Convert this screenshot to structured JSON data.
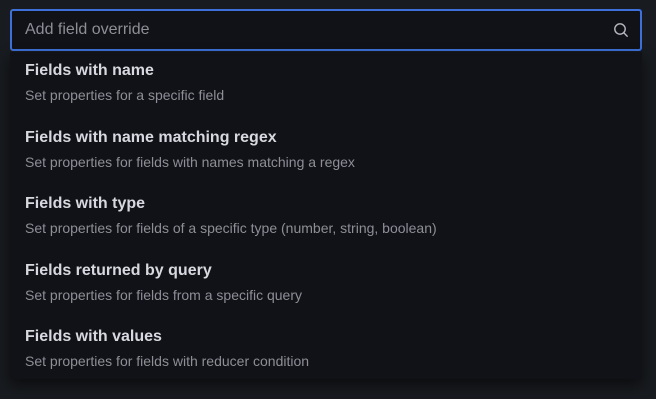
{
  "search": {
    "placeholder": "Add field override",
    "icon": "search-icon"
  },
  "colors": {
    "focus_border": "#3d71d9",
    "background": "#181b1f",
    "panel": "#111217",
    "title_text": "#d8d9e0",
    "description_text": "#8e8e97"
  },
  "options": [
    {
      "title": "Fields with name",
      "description": "Set properties for a specific field"
    },
    {
      "title": "Fields with name matching regex",
      "description": "Set properties for fields with names matching a regex"
    },
    {
      "title": "Fields with type",
      "description": "Set properties for fields of a specific type (number, string, boolean)"
    },
    {
      "title": "Fields returned by query",
      "description": "Set properties for fields from a specific query"
    },
    {
      "title": "Fields with values",
      "description": "Set properties for fields with reducer condition"
    }
  ]
}
